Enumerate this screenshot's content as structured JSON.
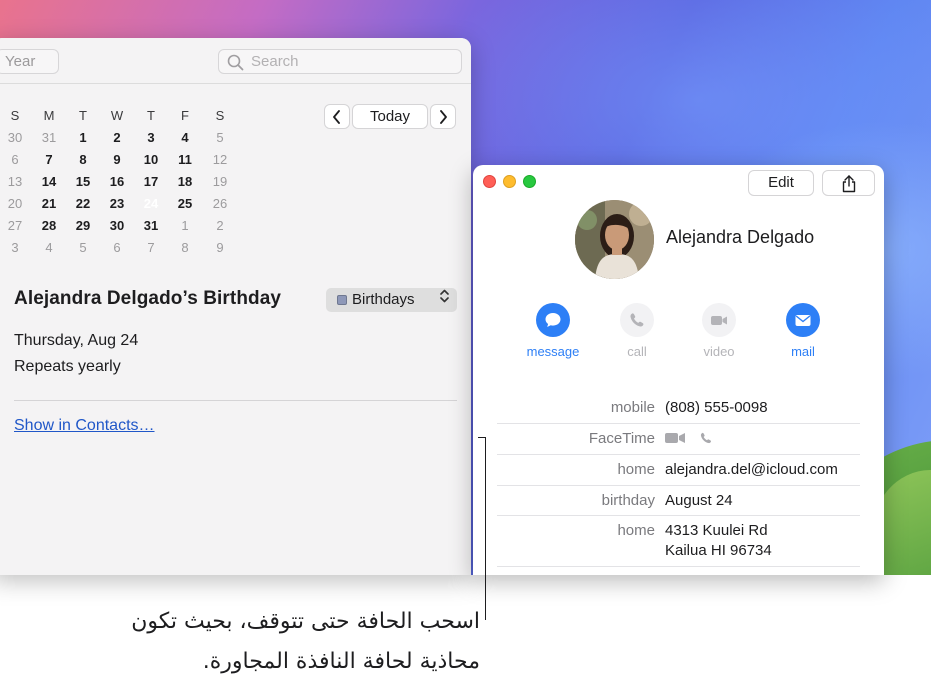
{
  "calendar": {
    "toolbar": {
      "year_label": "Year",
      "search_placeholder": "Search"
    },
    "nav": {
      "prev": "‹",
      "today": "Today",
      "next": "›"
    },
    "weekdays": [
      "S",
      "M",
      "T",
      "W",
      "T",
      "F",
      "S"
    ],
    "weeks": [
      [
        {
          "d": "30",
          "dim": true
        },
        {
          "d": "31",
          "dim": true
        },
        {
          "d": "1"
        },
        {
          "d": "2"
        },
        {
          "d": "3"
        },
        {
          "d": "4"
        },
        {
          "d": "5",
          "dim": true
        }
      ],
      [
        {
          "d": "6",
          "dim": true
        },
        {
          "d": "7"
        },
        {
          "d": "8"
        },
        {
          "d": "9"
        },
        {
          "d": "10"
        },
        {
          "d": "11"
        },
        {
          "d": "12",
          "dim": true
        }
      ],
      [
        {
          "d": "13",
          "dim": true
        },
        {
          "d": "14"
        },
        {
          "d": "15"
        },
        {
          "d": "16"
        },
        {
          "d": "17"
        },
        {
          "d": "18"
        },
        {
          "d": "19",
          "dim": true
        }
      ],
      [
        {
          "d": "20",
          "dim": true
        },
        {
          "d": "21"
        },
        {
          "d": "22"
        },
        {
          "d": "23"
        },
        {
          "d": "24",
          "selected": true
        },
        {
          "d": "25"
        },
        {
          "d": "26",
          "dim": true
        }
      ],
      [
        {
          "d": "27",
          "dim": true
        },
        {
          "d": "28"
        },
        {
          "d": "29"
        },
        {
          "d": "30"
        },
        {
          "d": "31"
        },
        {
          "d": "1",
          "dim": true
        },
        {
          "d": "2",
          "dim": true
        }
      ],
      [
        {
          "d": "3",
          "dim": true
        },
        {
          "d": "4",
          "dim": true
        },
        {
          "d": "5",
          "dim": true
        },
        {
          "d": "6",
          "dim": true
        },
        {
          "d": "7",
          "dim": true
        },
        {
          "d": "8",
          "dim": true
        },
        {
          "d": "9",
          "dim": true
        }
      ]
    ],
    "event": {
      "title": "Alejandra Delgado’s Birthday",
      "calendar_name": "Birthdays",
      "date": "Thursday, Aug 24",
      "repeat": "Repeats yearly",
      "link": "Show in Contacts…"
    }
  },
  "contact": {
    "edit_label": "Edit",
    "name": "Alejandra Delgado",
    "actions": [
      {
        "label": "message",
        "icon": "message-icon",
        "active": true
      },
      {
        "label": "call",
        "icon": "phone-icon",
        "active": false
      },
      {
        "label": "video",
        "icon": "video-icon",
        "active": false
      },
      {
        "label": "mail",
        "icon": "mail-icon",
        "active": true
      }
    ],
    "fields": {
      "mobile_label": "mobile",
      "mobile_value": "(808) 555-0098",
      "facetime_label": "FaceTime",
      "email_label": "home",
      "email_value": "alejandra.del@icloud.com",
      "birthday_label": "birthday",
      "birthday_value": "August 24",
      "address_label": "home",
      "address_line1": "4313 Kuulei Rd",
      "address_line2": "Kailua HI 96734"
    }
  },
  "callout": {
    "line1": "اسحب الحافة حتى تتوقف، بحيث تكون",
    "line2": "محاذية لحافة النافذة المجاورة."
  },
  "colors": {
    "accent": "#2d7ff6",
    "link": "#2057c8",
    "today_circle": "#3a3a3c"
  }
}
